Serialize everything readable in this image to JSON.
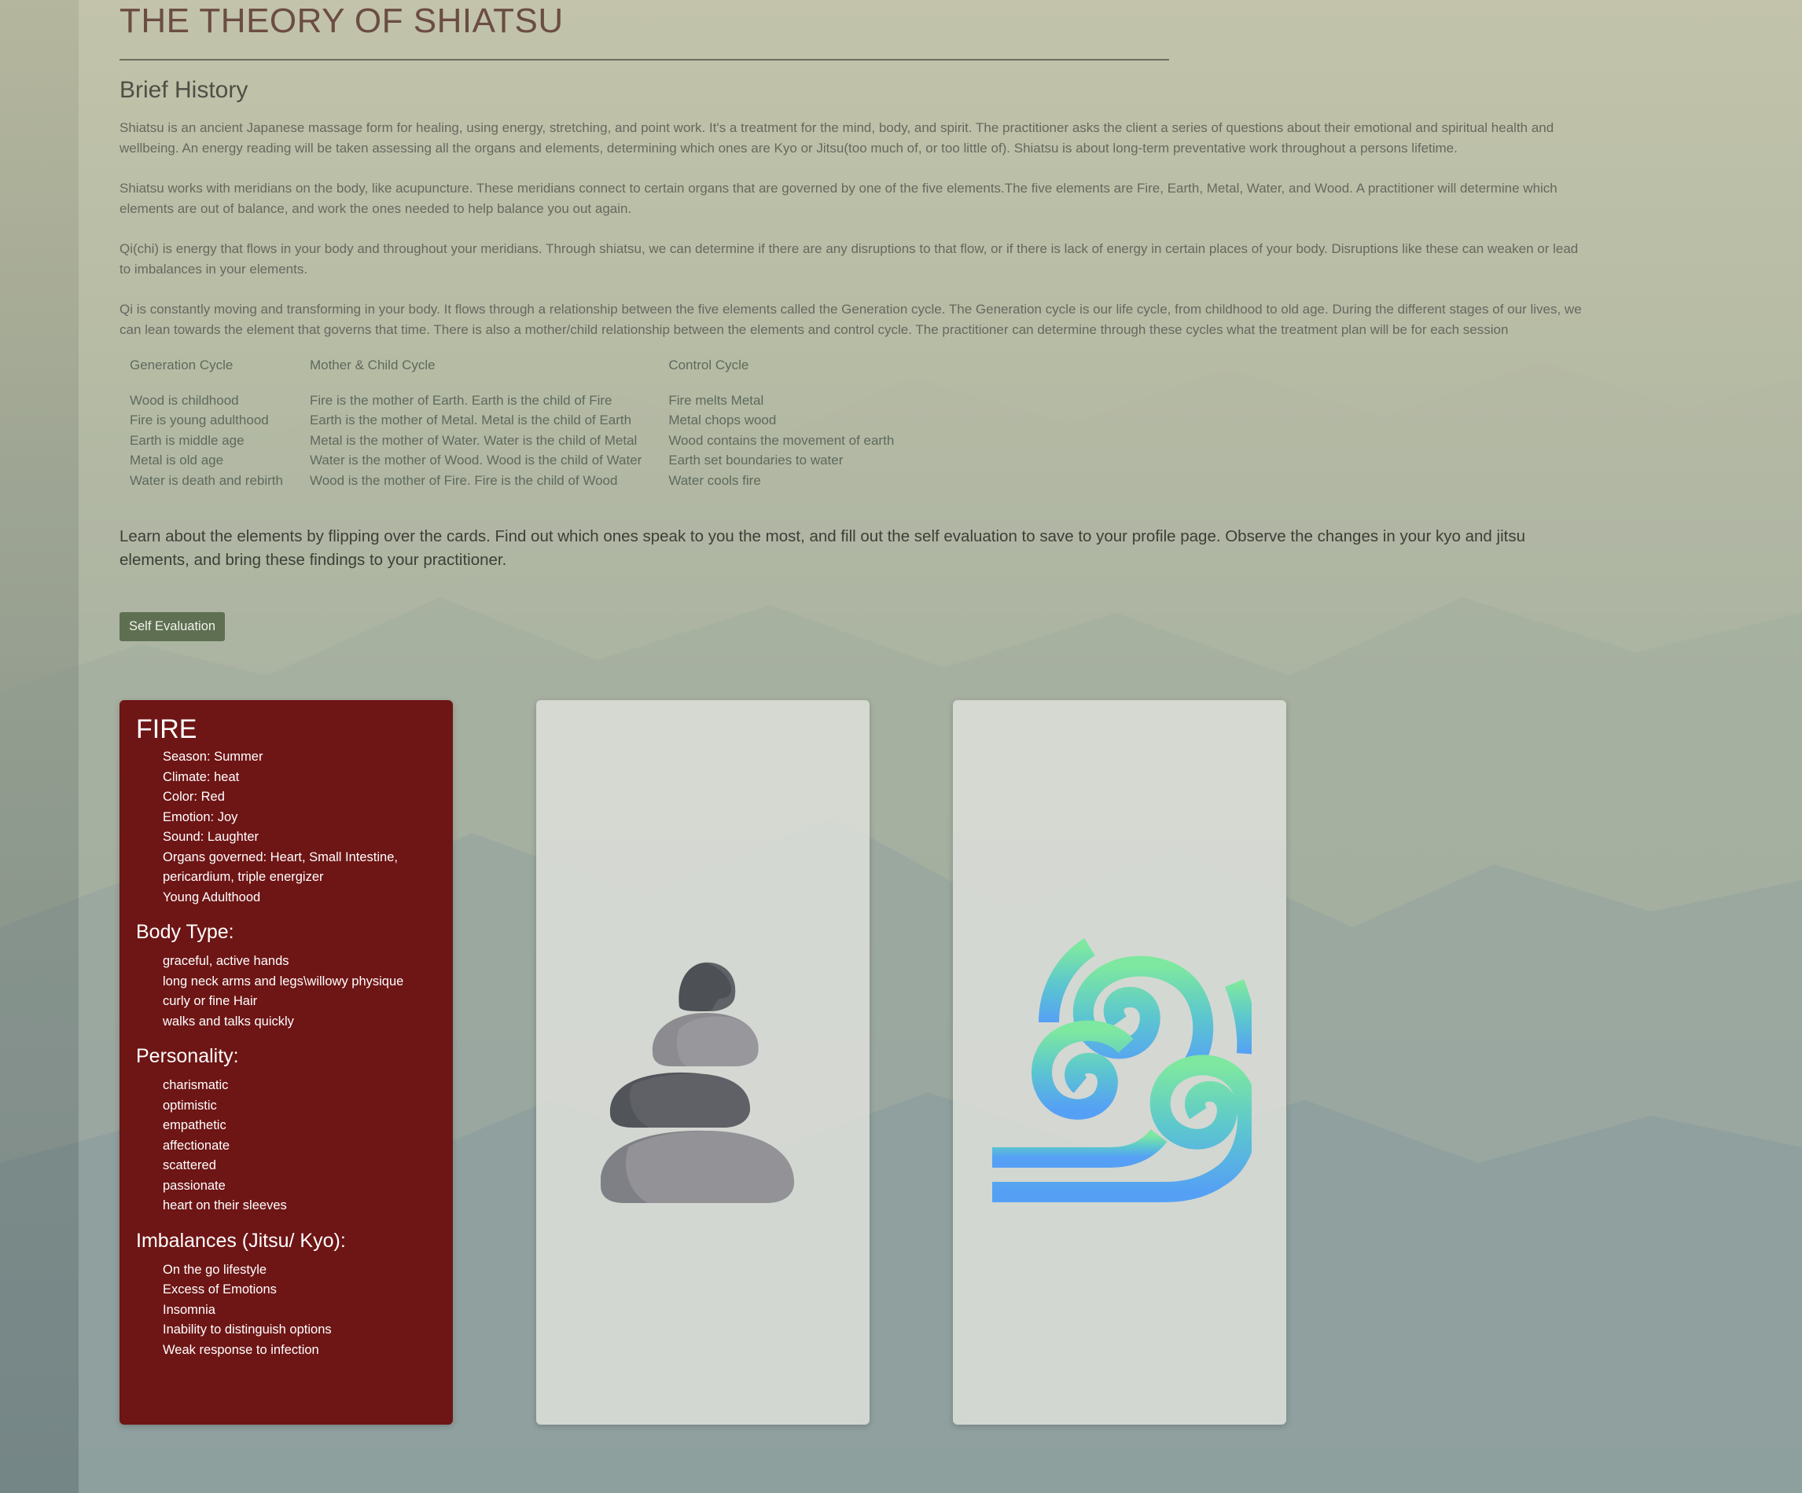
{
  "page": {
    "title": "THE THEORY OF SHIATSU",
    "subtitle": "Brief History",
    "paragraphs": [
      "Shiatsu is an ancient Japanese massage form for healing, using energy, stretching, and point work. It's a treatment for the mind, body, and spirit. The practitioner asks the client a series of questions about their emotional and spiritual health and wellbeing. An energy reading will be taken assessing all the organs and elements, determining which ones are Kyo or Jitsu(too much of, or too little of). Shiatsu is about long-term preventative work throughout a persons lifetime.",
      "Shiatsu works with meridians on the body, like acupuncture. These meridians connect to certain organs that are governed by one of the five elements.The five elements are Fire, Earth, Metal, Water, and Wood. A practitioner will determine which elements are out of balance, and work the ones needed to help balance you out again.",
      "Qi(chi) is energy that flows in your body and throughout your meridians. Through shiatsu, we can determine if there are any disruptions to that flow, or if there is lack of energy in certain places of your body. Disruptions like these can weaken or lead to imbalances in your elements.",
      "Qi is constantly moving and transforming in your body. It flows through a relationship between the five elements called the Generation cycle. The Generation cycle is our life cycle, from childhood to old age. During the different stages of our lives, we can lean towards the element that governs that time. There is also a mother/child relationship between the elements and control cycle. The practitioner can determine through these cycles what the treatment plan will be for each session"
    ]
  },
  "cycles": {
    "headers": [
      "Generation Cycle",
      "Mother & Child Cycle",
      "Control Cycle"
    ],
    "rows": [
      [
        "Wood is childhood",
        "Fire is the mother of Earth. Earth is the child of Fire",
        "Fire melts Metal"
      ],
      [
        "Fire is young adulthood",
        "Earth is the mother of Metal. Metal is the child of Earth",
        "Metal chops wood"
      ],
      [
        "Earth is middle age",
        "Metal is the mother of Water. Water is the child of Metal",
        "Wood contains the movement of earth"
      ],
      [
        "Metal is old age",
        "Water is the mother of Wood. Wood is the child of Water",
        "Earth set boundaries to water"
      ],
      [
        "Water is death and rebirth",
        "Wood is the mother of Fire. Fire is the child of Wood",
        "Water cools fire"
      ]
    ]
  },
  "intro": "Learn about the elements by flipping over the cards. Find out which ones speak to you the most, and fill out the self evaluation to save to your profile page. Observe the changes in your kyo and jitsu elements, and bring these findings to your practitioner.",
  "buttons": {
    "self_eval": "Self Evaluation"
  },
  "fire_card": {
    "title": "FIRE",
    "attributes": [
      "Season: Summer",
      "Climate: heat",
      "Color: Red",
      "Emotion: Joy",
      "Sound: Laughter",
      "Organs governed: Heart, Small Intestine, pericardium, triple energizer",
      "Young Adulthood"
    ],
    "body_type_heading": "Body Type:",
    "body_type": [
      "graceful, active hands",
      "long neck arms and legs\\willowy physique",
      "curly or fine Hair",
      "walks and talks quickly"
    ],
    "personality_heading": "Personality:",
    "personality": [
      "charismatic",
      "optimistic",
      "empathetic",
      "affectionate",
      "scattered",
      "passionate",
      "heart on their sleeves"
    ],
    "imbalances_heading": "Imbalances (Jitsu/ Kyo):",
    "imbalances": [
      "On the go lifestyle",
      "Excess of Emotions",
      "Insomnia",
      "Inability to distinguish options",
      "Weak response to infection"
    ]
  },
  "icons": {
    "stone_card": "stacked-stones-icon",
    "air_card": "wind-swirl-icon"
  },
  "colors": {
    "fire_card": "#6e1515",
    "button": "#5e6f52",
    "title": "#6b4c43",
    "card_back": "#dcded8",
    "wind_gradient_top": "#7ee8a0",
    "wind_gradient_bottom": "#55a0f5"
  }
}
